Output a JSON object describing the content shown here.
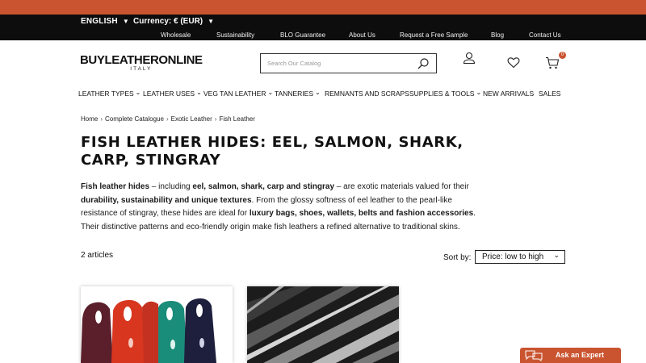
{
  "top_bar": {
    "language": "ENGLISH",
    "currency": "Currency: € (EUR)",
    "links": [
      "Wholesale",
      "Sustainability",
      "BLO Guarantee",
      "About Us",
      "Request a Free Sample",
      "Blog",
      "Contact Us"
    ]
  },
  "logo": {
    "main": "BUYLEATHERONLINE",
    "sub": "ITALY"
  },
  "search": {
    "placeholder": "Search Our Catalog",
    "icon": "search-icon"
  },
  "header_icons": {
    "account": "user-icon",
    "wishlist": "heart-icon",
    "cart": "cart-icon",
    "cart_count": "0"
  },
  "nav": {
    "items": [
      {
        "label": "LEATHER TYPES",
        "dropdown": true
      },
      {
        "label": "LEATHER USES",
        "dropdown": true
      },
      {
        "label": "VEG TAN LEATHER",
        "dropdown": true
      },
      {
        "label": "TANNERIES",
        "dropdown": true
      },
      {
        "label": "REMNANTS AND SCRAPS",
        "dropdown": false
      },
      {
        "label": "SUPPLIES & TOOLS",
        "dropdown": true
      },
      {
        "label": "NEW ARRIVALS",
        "dropdown": false
      },
      {
        "label": "SALES",
        "dropdown": false
      }
    ]
  },
  "breadcrumb": [
    "Home",
    "Complete Catalogue",
    "Exotic Leather",
    "Fish Leather"
  ],
  "page": {
    "title": "FISH LEATHER HIDES: EEL, SALMON, SHARK, CARP, STINGRAY",
    "description": {
      "s1": "Fish leather hides",
      "s2": " – including ",
      "s3": "eel, salmon, shark, carp and stingray",
      "s4": " – are exotic materials valued for their ",
      "s5": "durability, sustainability and unique textures",
      "s6": ". From the glossy softness of eel leather to the pearl-like resistance of stingray, these hides are ideal for ",
      "s7": "luxury bags, shoes, wallets, belts and fashion accessories",
      "s8": ". Their distinctive patterns and eco-friendly origin make fish leathers a refined alternative to traditional skins."
    }
  },
  "listing": {
    "count": "2 articles",
    "sort_label": "Sort by:",
    "sort_value": "Price: low to high"
  },
  "products": [
    {
      "image": "stingray-hides-colors"
    },
    {
      "image": "eel-leather-black"
    }
  ],
  "chat": {
    "label": "Ask an Expert",
    "icon": "chat-bubbles-icon"
  },
  "colors": {
    "accent": "#c9542f",
    "topbar": "#0d0d0d"
  }
}
